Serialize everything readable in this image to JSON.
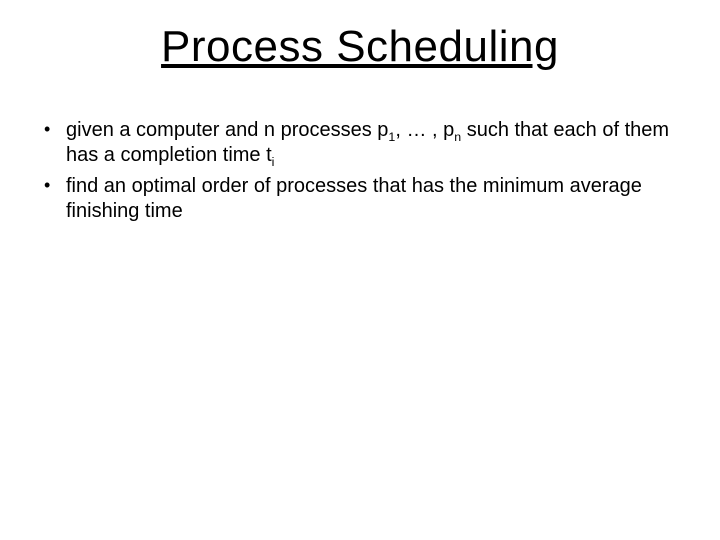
{
  "title": "Process Scheduling",
  "bullets": [
    {
      "pre": "given a computer and n processes p",
      "s1": "1",
      "mid1": ", … , p",
      "s2": "n",
      "mid2": " such that each of them has a completion time t",
      "s3": "i",
      "post": ""
    },
    {
      "text": "find an optimal order of processes that has the minimum average finishing time"
    }
  ]
}
